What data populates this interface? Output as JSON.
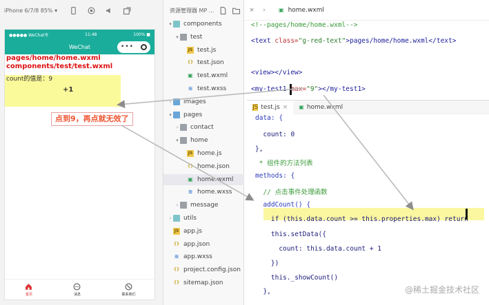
{
  "simulator": {
    "device_label": "iPhone 6/7/8 85% ▾",
    "statusbar": {
      "carrier": "●●●●● WeChat令",
      "time": "11:48",
      "battery": "100% ■"
    },
    "navbar_title": "WeChat",
    "capsule_dots": "•••",
    "page_line1": "pages/home/home.wxml",
    "page_line2": "components/test/test.wxml",
    "count_label": "count的值是：9",
    "plus_label": "+1",
    "tabs": [
      {
        "label": "首页",
        "icon": "home-icon",
        "active": true
      },
      {
        "label": "消息",
        "icon": "message-icon",
        "active": false
      },
      {
        "label": "联系我们",
        "icon": "contact-icon",
        "active": false
      }
    ],
    "accent_color": "#1aad9b"
  },
  "annotation": {
    "text": "点到9，再点就无效了",
    "color": "#e53"
  },
  "tree": {
    "header_label": "资源管理器 MP ...",
    "rows": [
      {
        "label": "components",
        "kind": "folder"
      },
      {
        "label": "test",
        "kind": "folder"
      },
      {
        "label": "test.js",
        "kind": "js"
      },
      {
        "label": "test.json",
        "kind": "json"
      },
      {
        "label": "test.wxml",
        "kind": "wxml"
      },
      {
        "label": "test.wxss",
        "kind": "wxss"
      },
      {
        "label": "images",
        "kind": "folder"
      },
      {
        "label": "pages",
        "kind": "folder"
      },
      {
        "label": "contact",
        "kind": "folder"
      },
      {
        "label": "home",
        "kind": "folder"
      },
      {
        "label": "home.js",
        "kind": "js"
      },
      {
        "label": "home.json",
        "kind": "json"
      },
      {
        "label": "home.wxml",
        "kind": "wxml"
      },
      {
        "label": "home.wxss",
        "kind": "wxss"
      },
      {
        "label": "message",
        "kind": "folder"
      },
      {
        "label": "utils",
        "kind": "folder"
      },
      {
        "label": "app.js",
        "kind": "js"
      },
      {
        "label": "app.json",
        "kind": "json"
      },
      {
        "label": "app.wxss",
        "kind": "wxss"
      },
      {
        "label": "project.config.json",
        "kind": "json"
      },
      {
        "label": "sitemap.json",
        "kind": "json"
      }
    ]
  },
  "editor": {
    "tab_label": "home.wxml",
    "lines": {
      "l1": "<!--pages/home/home.wxml-->",
      "l2_open": "<text ",
      "l2_attr": "class=",
      "l2_val": "\"g-red-text\"",
      "l2_rest": ">pages/home/home.wxml</text>",
      "l3": "<view></view>",
      "l4_open": "<my-test1 ",
      "l4_attr": "max=",
      "l4_val": "\"9\"",
      "l4_rest": "></my-test1>"
    },
    "split_tabs": [
      "test.js",
      "home.wxml"
    ],
    "split_lines": [
      "data: {",
      "  count: 0",
      "},",
      " * 组件的方法列表",
      "methods: {",
      "  // 点击事件处理函数",
      "  addCount() {",
      "    if (this.data.count >= this.properties.max) return",
      "    this.setData({",
      "      count: this.data.count + 1",
      "    })",
      "    this._showCount()",
      "  },"
    ]
  },
  "watermark": "@稀土掘金技术社区"
}
